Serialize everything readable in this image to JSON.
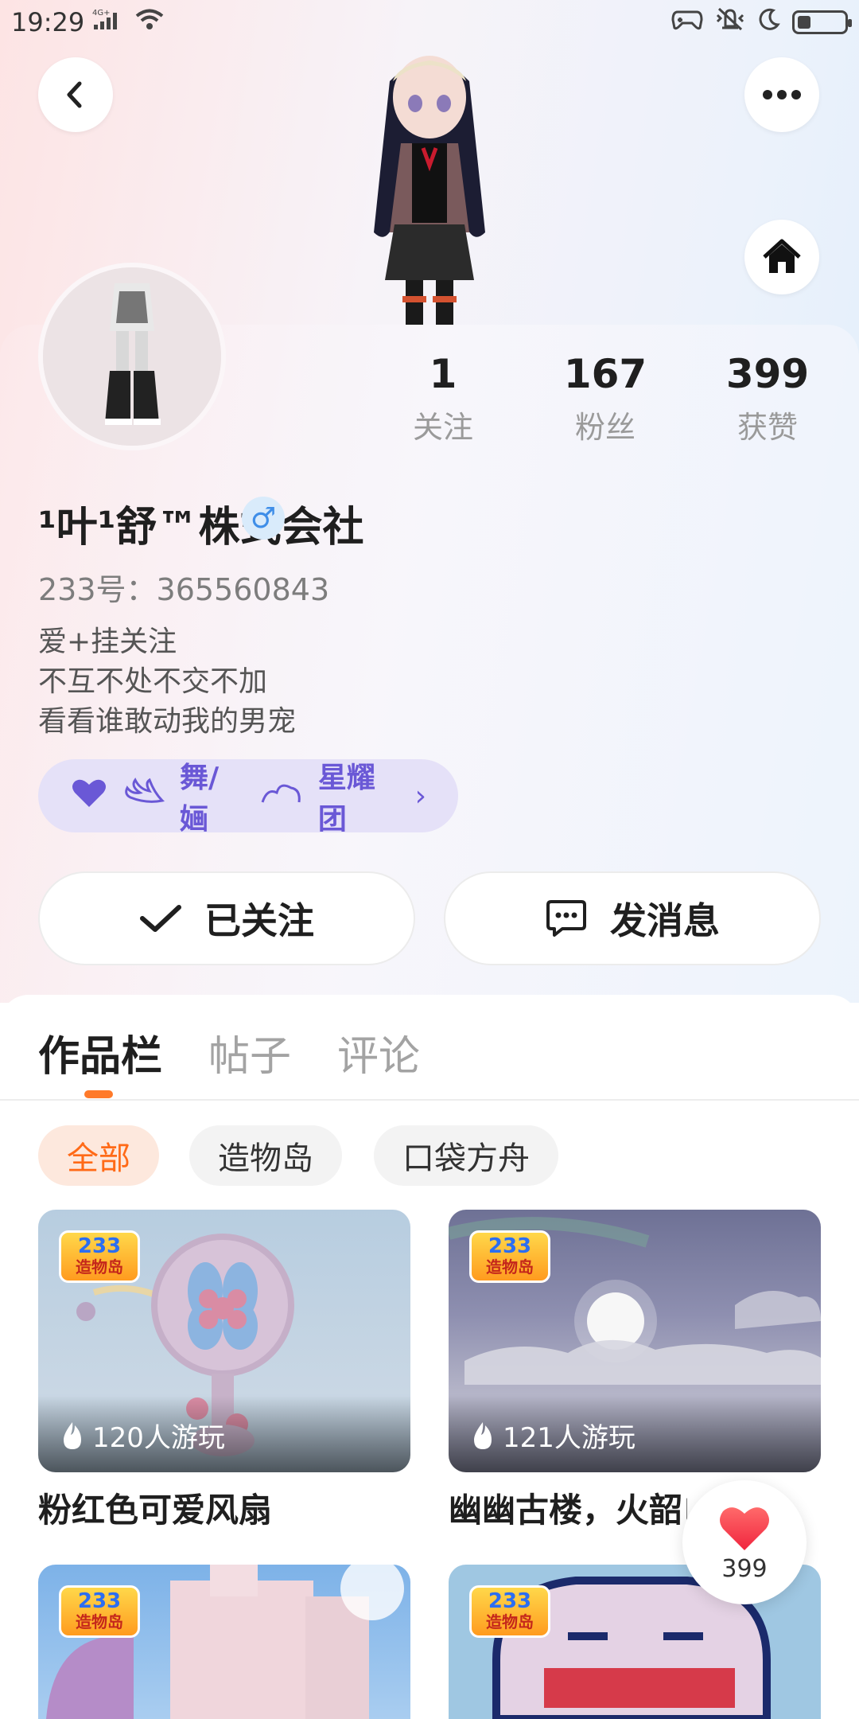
{
  "status_bar": {
    "time": "19:29",
    "network": "4G+",
    "icons": [
      "signal-icon",
      "wifi-icon",
      "gamepad-icon",
      "vibrate-icon",
      "moon-icon",
      "battery-icon"
    ]
  },
  "header": {
    "back_icon": "chevron-left-icon",
    "more_icon": "more-dots-icon",
    "home_icon": "home-icon"
  },
  "stats": {
    "following": {
      "value": "1",
      "label": "关注"
    },
    "fans": {
      "value": "167",
      "label": "粉丝"
    },
    "likes": {
      "value": "399",
      "label": "获赞"
    }
  },
  "profile": {
    "username": "¹叶¹舒™株式会社",
    "gender_icon": "♂",
    "uid": "233号：365560843",
    "bio": [
      "爱+挂关注",
      "不互不处不交不加",
      "看看谁敢动我的男宠"
    ]
  },
  "group": {
    "name_part1": "舞/婳",
    "name_part2": "星耀团",
    "chevron": "›"
  },
  "actions": {
    "follow_label": "已关注",
    "message_label": "发消息"
  },
  "tabs": [
    "作品栏",
    "帖子",
    "评论"
  ],
  "filters": [
    "全部",
    "造物岛",
    "口袋方舟"
  ],
  "badge": {
    "number": "233",
    "text": "造物岛"
  },
  "works": [
    {
      "title": "粉红色可爱风扇",
      "plays": "120人游玩"
    },
    {
      "title": "幽幽古楼，火韶白",
      "plays": "121人游玩"
    }
  ],
  "like_float": {
    "count": "399"
  },
  "colors": {
    "accent_orange": "#ff6a17",
    "group_purple": "#6a58d6",
    "gender_blue": "#3f8ee8"
  }
}
